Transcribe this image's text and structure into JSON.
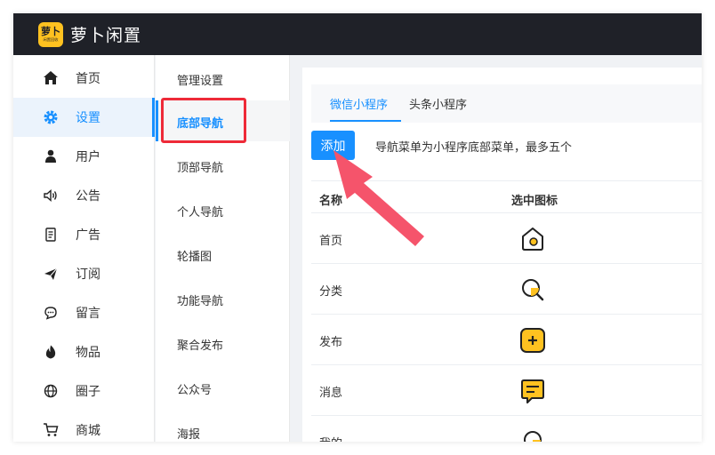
{
  "app": {
    "logo_text_big": "萝卜",
    "logo_text_small": "闲置回收",
    "title": "萝卜闲置"
  },
  "sidebar": {
    "items": [
      {
        "label": "首页",
        "icon": "home-icon",
        "active": false
      },
      {
        "label": "设置",
        "icon": "gear-icon",
        "active": true
      },
      {
        "label": "用户",
        "icon": "user-icon",
        "active": false
      },
      {
        "label": "公告",
        "icon": "speaker-icon",
        "active": false
      },
      {
        "label": "广告",
        "icon": "document-icon",
        "active": false
      },
      {
        "label": "订阅",
        "icon": "send-icon",
        "active": false
      },
      {
        "label": "留言",
        "icon": "chat-icon",
        "active": false
      },
      {
        "label": "物品",
        "icon": "fire-icon",
        "active": false
      },
      {
        "label": "圈子",
        "icon": "globe-icon",
        "active": false
      },
      {
        "label": "商城",
        "icon": "cart-icon",
        "active": false
      }
    ]
  },
  "subnav": {
    "items": [
      {
        "label": "管理设置",
        "active": false
      },
      {
        "label": "底部导航",
        "active": true
      },
      {
        "label": "顶部导航",
        "active": false
      },
      {
        "label": "个人导航",
        "active": false
      },
      {
        "label": "轮播图",
        "active": false
      },
      {
        "label": "功能导航",
        "active": false
      },
      {
        "label": "聚合发布",
        "active": false
      },
      {
        "label": "公众号",
        "active": false
      },
      {
        "label": "海报",
        "active": false
      }
    ]
  },
  "main": {
    "tabs": [
      {
        "label": "微信小程序",
        "active": true
      },
      {
        "label": "头条小程序",
        "active": false
      }
    ],
    "add_button": "添加",
    "hint": "导航菜单为小程序底部菜单，最多五个",
    "table": {
      "headers": [
        "名称",
        "选中图标"
      ],
      "rows": [
        {
          "name": "首页",
          "icon": "home-selected-icon"
        },
        {
          "name": "分类",
          "icon": "search-selected-icon"
        },
        {
          "name": "发布",
          "icon": "plus-selected-icon"
        },
        {
          "name": "消息",
          "icon": "message-selected-icon"
        },
        {
          "name": "我的",
          "icon": "profile-selected-icon"
        }
      ]
    }
  },
  "colors": {
    "topbar": "#1f2128",
    "accent": "#1890ff",
    "brand_yellow": "#ffc220",
    "annotation_red": "#ee2a38",
    "arrow_pink": "#f5546b"
  }
}
